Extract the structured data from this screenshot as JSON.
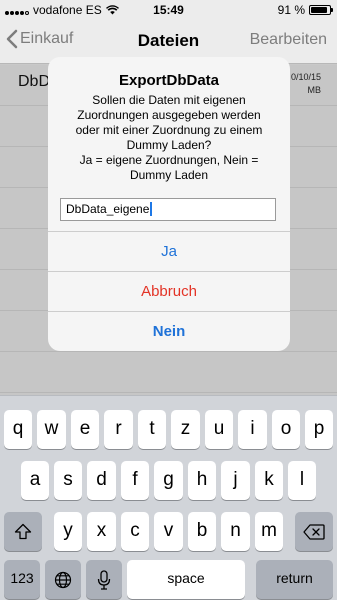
{
  "status": {
    "carrier": "vodafone ES",
    "time": "15:49",
    "battery": "91 %",
    "battery_level": 0.91,
    "signal_bars": 4
  },
  "nav": {
    "back_label": "Einkauf",
    "title": "Dateien",
    "edit_label": "Bearbeiten"
  },
  "list": {
    "item": {
      "name": "DbD",
      "date": "0/10/15",
      "size": "MB"
    }
  },
  "alert": {
    "title": "ExportDbData",
    "message_lines": [
      "Sollen die Daten mit eigenen",
      "Zuordnungen ausgegeben werden",
      "oder mit einer Zuordnung zu einem",
      "Dummy Laden?",
      "Ja = eigene Zuordnungen, Nein =",
      "Dummy Laden"
    ],
    "input_value": "DbData_eigene",
    "buttons": {
      "ja": "Ja",
      "abbruch": "Abbruch",
      "nein": "Nein"
    },
    "colors": {
      "primary": "#1f72d8",
      "destructive": "#e33326"
    }
  },
  "keyboard": {
    "row1": [
      "q",
      "w",
      "e",
      "r",
      "t",
      "z",
      "u",
      "i",
      "o",
      "p"
    ],
    "row2": [
      "a",
      "s",
      "d",
      "f",
      "g",
      "h",
      "j",
      "k",
      "l"
    ],
    "row3": [
      "y",
      "x",
      "c",
      "v",
      "b",
      "n",
      "m"
    ],
    "numbers_label": "123",
    "space_label": "space",
    "return_label": "return",
    "icons": {
      "shift": "shift-icon",
      "backspace": "backspace-icon",
      "globe": "globe-icon",
      "mic": "microphone-icon"
    }
  }
}
